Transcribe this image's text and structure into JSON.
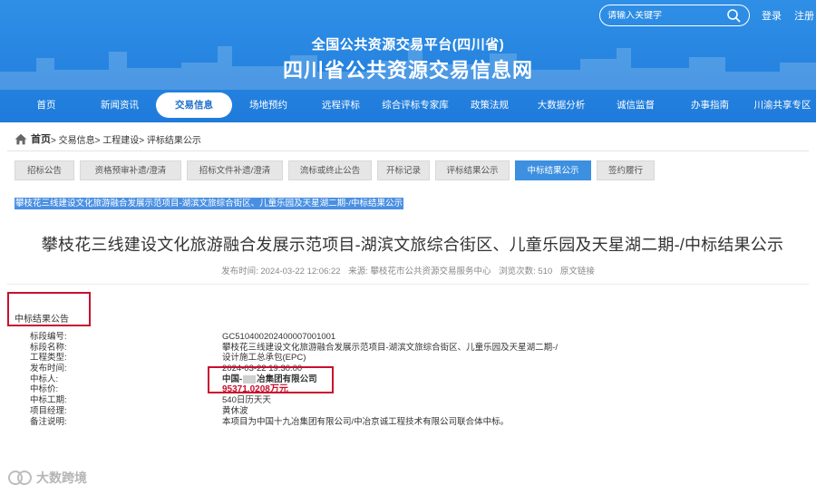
{
  "header": {
    "search_placeholder": "请输入关键字",
    "login": "登录",
    "register": "注册",
    "site_subtitle": "全国公共资源交易平台(四川省)",
    "site_title": "四川省公共资源交易信息网"
  },
  "nav": {
    "items": [
      {
        "label": "首页"
      },
      {
        "label": "新闻资讯"
      },
      {
        "label": "交易信息"
      },
      {
        "label": "场地预约"
      },
      {
        "label": "远程评标"
      },
      {
        "label": "综合评标专家库"
      },
      {
        "label": "政策法规"
      },
      {
        "label": "大数据分析"
      },
      {
        "label": "诚信监督"
      },
      {
        "label": "办事指南"
      },
      {
        "label": "川渝共享专区"
      }
    ],
    "active": "交易信息"
  },
  "breadcrumb": {
    "home": "首页",
    "rest": "> 交易信息> 工程建设> 评标结果公示"
  },
  "subtabs": {
    "items": [
      {
        "label": "招标公告"
      },
      {
        "label": "资格预审补遗/澄清"
      },
      {
        "label": "招标文件补遗/澄清"
      },
      {
        "label": "流标或终止公告"
      },
      {
        "label": "开标记录"
      },
      {
        "label": "评标结果公示"
      },
      {
        "label": "中标结果公示"
      },
      {
        "label": "签约履行"
      }
    ],
    "active": "中标结果公示"
  },
  "article": {
    "selected_title": "攀枝花三线建设文化旅游融合发展示范项目-湖滨文旅综合街区、儿童乐园及天星湖二期-/中标结果公示",
    "title": "攀枝花三线建设文化旅游融合发展示范项目-湖滨文旅综合街区、儿童乐园及天星湖二期-/中标结果公示",
    "meta": {
      "publish_time": "发布时间: 2024-03-22 12:06:22",
      "source": "来源: 攀枝花市公共资源交易服务中心",
      "views": "浏览次数: 510",
      "original_link": "原文链接"
    },
    "section_label": "中标结果公告",
    "fields": {
      "section_no": {
        "label": "标段编号:",
        "value": "GC5104002024000070010​01"
      },
      "section_name": {
        "label": "标段名称:",
        "value": "攀枝花三线建设文化旅游融合发展示范项目-湖滨文旅综合街区、儿童乐园及天星湖二期-/"
      },
      "project_type": {
        "label": "工程类型:",
        "value": "设计施工总承包(EPC)"
      },
      "publish_time": {
        "label": "发布时间:",
        "value": "2024-03-22 19:30:00"
      },
      "winner": {
        "label": "中标人:",
        "value_prefix": "中国-",
        "value_suffix": "冶集团有限公司"
      },
      "price": {
        "label": "中标价:",
        "value": "95371.0208万元"
      },
      "duration": {
        "label": "中标工期:",
        "value": "540日历天天"
      },
      "manager": {
        "label": "项目经理:",
        "value": "黄休波"
      },
      "remark": {
        "label": "备注说明:",
        "value": "本项目为中国十九冶集团有限公司/中冶京诚工程技术有限公司联合体中标。"
      }
    }
  },
  "watermark": {
    "text": "大数跨境"
  },
  "colors": {
    "header_blue": "#2f8fe6",
    "active_tab": "#3d8fe0",
    "annotation_red": "#c8102e"
  }
}
